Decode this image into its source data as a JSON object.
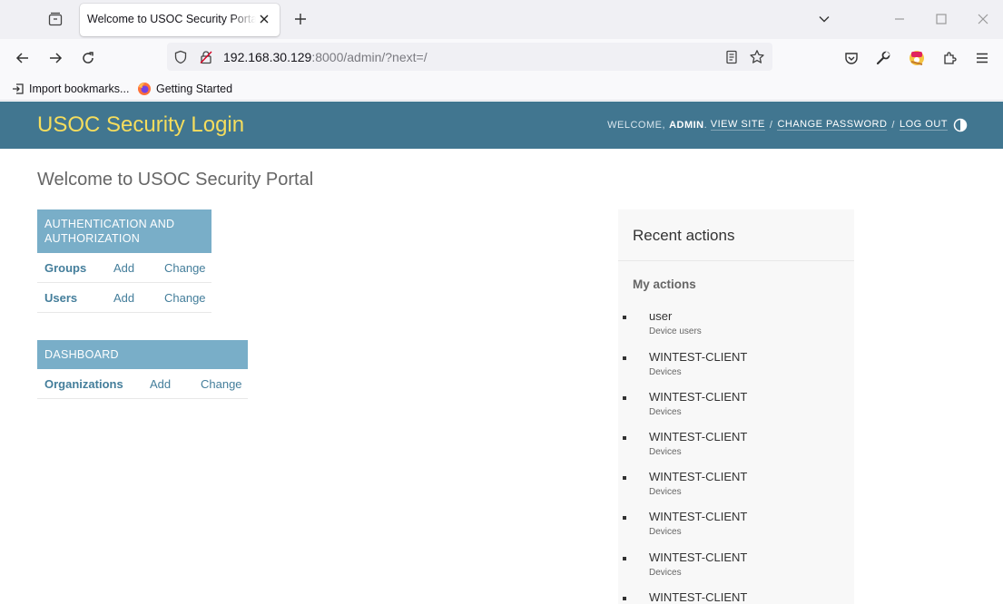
{
  "browser": {
    "tab_title": "Welcome to USOC Security Portal | Django site admin",
    "url_host": "192.168.30.129",
    "url_rest": ":8000/admin/?next=/",
    "bookmarks": [
      "Import bookmarks...",
      "Getting Started"
    ]
  },
  "header": {
    "branding": "USOC Security Login",
    "welcome": "WELCOME,",
    "username": "ADMIN",
    "links": [
      "VIEW SITE",
      "CHANGE PASSWORD",
      "LOG OUT"
    ]
  },
  "content": {
    "title": "Welcome to USOC Security Portal",
    "add_label": "Add",
    "change_label": "Change",
    "modules": [
      {
        "caption_line1": "AUTHENTICATION AND",
        "caption_line2": "AUTHORIZATION",
        "models": [
          "Groups",
          "Users"
        ]
      },
      {
        "caption": "DASHBOARD",
        "models": [
          "Organizations"
        ]
      }
    ]
  },
  "recent_actions": {
    "title": "Recent actions",
    "subtitle": "My actions",
    "items": [
      {
        "name": "user",
        "type": "Device users"
      },
      {
        "name": "WINTEST-CLIENT",
        "type": "Devices"
      },
      {
        "name": "WINTEST-CLIENT",
        "type": "Devices"
      },
      {
        "name": "WINTEST-CLIENT",
        "type": "Devices"
      },
      {
        "name": "WINTEST-CLIENT",
        "type": "Devices"
      },
      {
        "name": "WINTEST-CLIENT",
        "type": "Devices"
      },
      {
        "name": "WINTEST-CLIENT",
        "type": "Devices"
      },
      {
        "name": "WINTEST-CLIENT",
        "type": ""
      }
    ]
  },
  "colors": {
    "header_bg": "#417690",
    "branding": "#f5dd5d",
    "module_caption": "#79aec8",
    "link": "#447e9b"
  }
}
